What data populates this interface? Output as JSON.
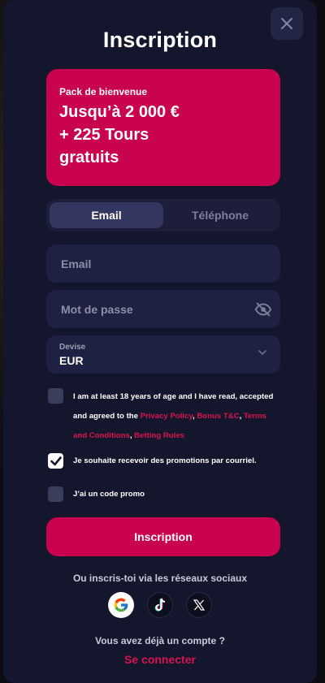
{
  "modal": {
    "title": "Inscription"
  },
  "promo": {
    "eyebrow": "Pack de bienvenue",
    "headline": "Jusqu’à 2 000 €\n+ 225 Tours\ngratuits"
  },
  "tabs": [
    {
      "label": "Email",
      "active": true
    },
    {
      "label": "Téléphone",
      "active": false
    }
  ],
  "form": {
    "email_placeholder": "Email",
    "password_placeholder": "Mot de passe",
    "currency_label": "Devise",
    "currency_value": "EUR"
  },
  "terms": {
    "text1": "I am at least 18 years of age and I have read, accepted and agreed to the ",
    "privacy": "Privacy Policy",
    "sep1": ", ",
    "bonus": "Bonus T&C",
    "sep2": ", ",
    "conditions": "Terms and Conditions",
    "sep3": ", ",
    "betting": "Betting Rules",
    "checked": false
  },
  "promotions": {
    "label": "Je souhaite recevoir des promotions par courriel.",
    "checked": true
  },
  "promo_code": {
    "label": "J’ai un code promo",
    "checked": false
  },
  "submit_label": "Inscription",
  "social": {
    "caption": "Ou inscris-toi via les réseaux sociaux",
    "providers": [
      "google-icon",
      "tiktok-icon",
      "x-icon"
    ]
  },
  "login": {
    "question": "Vous avez déjà un compte ?",
    "link": "Se connecter"
  },
  "colors": {
    "accent": "#c8024f",
    "background": "#14162e",
    "field": "#1f2142"
  }
}
